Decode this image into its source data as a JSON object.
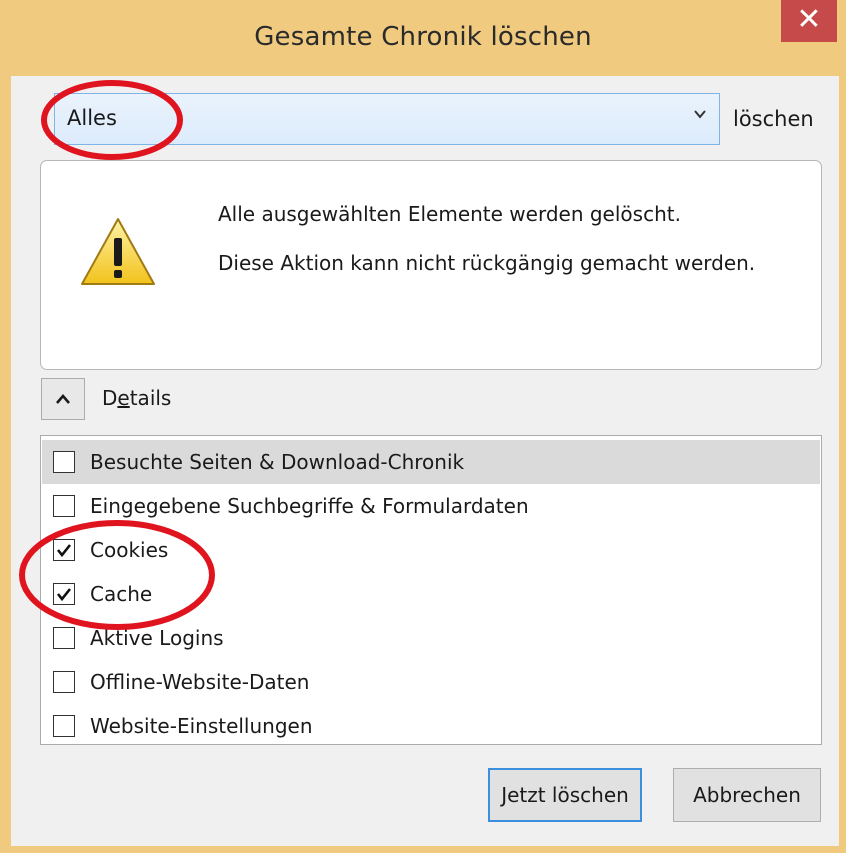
{
  "window": {
    "title": "Gesamte Chronik löschen",
    "close_glyph": "✕"
  },
  "timerange": {
    "selected": "Alles",
    "suffix_label": "löschen"
  },
  "warning": {
    "icon": "warning-triangle-icon",
    "line1": "Alle ausgewählten Elemente werden gelöscht.",
    "line2": "Diese Aktion kann nicht rückgängig gemacht werden."
  },
  "details": {
    "label_accel": "e",
    "label_rest": "tails",
    "label_prefix": "D",
    "expanded": true
  },
  "items": [
    {
      "label": "Besuchte Seiten & Download-Chronik",
      "checked": false,
      "selected": true
    },
    {
      "label": "Eingegebene Suchbegriffe & Formulardaten",
      "checked": false,
      "selected": false
    },
    {
      "label": "Cookies",
      "checked": true,
      "selected": false
    },
    {
      "label": "Cache",
      "checked": true,
      "selected": false
    },
    {
      "label": "Aktive Logins",
      "checked": false,
      "selected": false
    },
    {
      "label": "Offline-Website-Daten",
      "checked": false,
      "selected": false
    },
    {
      "label": "Website-Einstellungen",
      "checked": false,
      "selected": false
    }
  ],
  "buttons": {
    "clear_now": "Jetzt löschen",
    "cancel": "Abbrechen"
  },
  "colors": {
    "frame": "#f0ca7f",
    "close": "#c74a4a",
    "annotation": "#e0141e",
    "focus": "#3c8fde"
  }
}
